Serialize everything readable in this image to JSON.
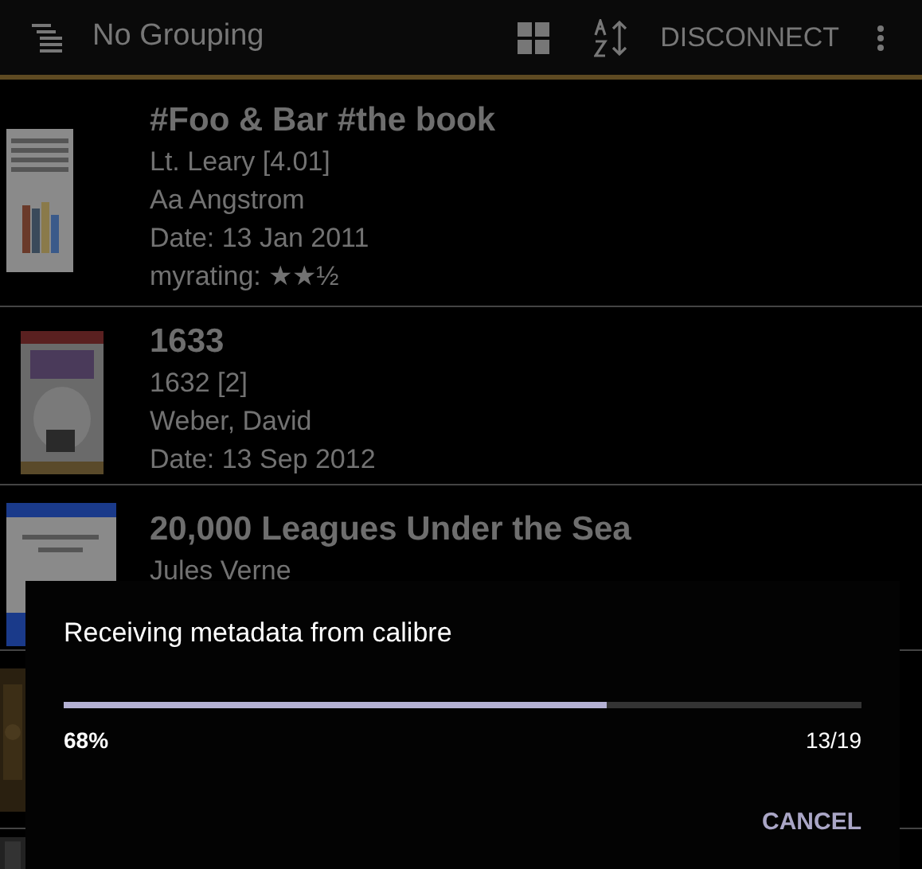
{
  "toolbar": {
    "title": "No Grouping",
    "action": "DISCONNECT"
  },
  "books": [
    {
      "title": "#Foo & Bar #the book",
      "lines": [
        "Lt. Leary [4.01]",
        "Aa Angstrom",
        "Date: 13 Jan 2011",
        "myrating: ★★½"
      ]
    },
    {
      "title": "1633",
      "lines": [
        "1632 [2]",
        "Weber, David",
        "Date: 13 Sep 2012"
      ]
    },
    {
      "title": "20,000 Leagues Under the Sea",
      "lines": [
        "Jules Verne"
      ]
    }
  ],
  "dialog": {
    "title": "Receiving metadata from calibre",
    "progress": {
      "level": 0.68
    },
    "percent": "68%",
    "count": "13/19",
    "button": "CANCEL"
  }
}
